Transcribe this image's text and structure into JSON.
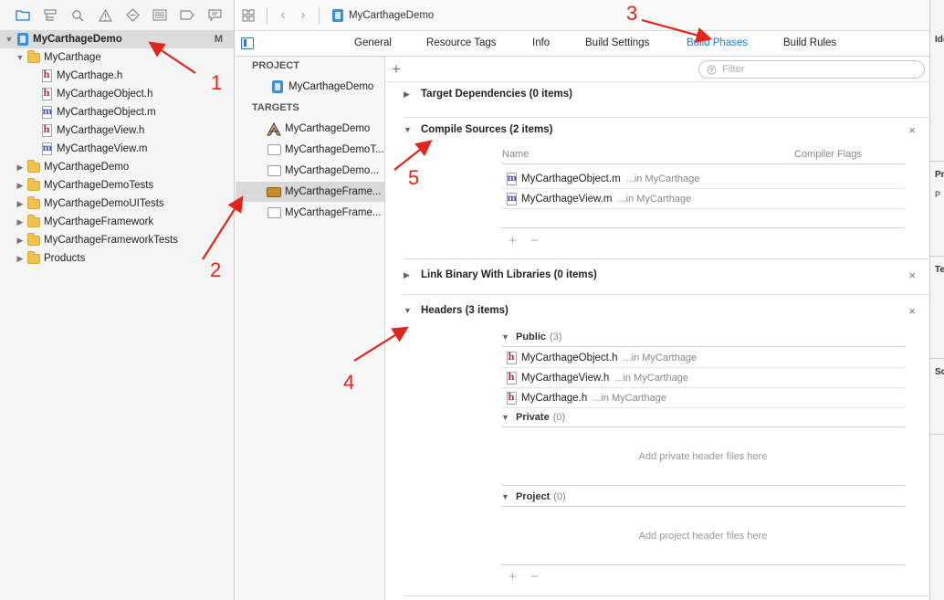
{
  "navigator": {
    "toolbar_icons": [
      "folder-icon",
      "hierarchy-icon",
      "search-icon",
      "warning-icon",
      "test-icon",
      "debug-list-icon",
      "breakpoint-icon",
      "report-icon"
    ],
    "items": [
      {
        "label": "MyCarthageDemo",
        "kind": "project",
        "disclosure": "▼",
        "badge": "M"
      },
      {
        "label": "MyCarthage",
        "kind": "folder",
        "disclosure": "▼"
      },
      {
        "label": "MyCarthage.h",
        "kind": "h"
      },
      {
        "label": "MyCarthageObject.h",
        "kind": "h"
      },
      {
        "label": "MyCarthageObject.m",
        "kind": "m"
      },
      {
        "label": "MyCarthageView.h",
        "kind": "h"
      },
      {
        "label": "MyCarthageView.m",
        "kind": "m"
      },
      {
        "label": "MyCarthageDemo",
        "kind": "folder",
        "disclosure": "▶"
      },
      {
        "label": "MyCarthageDemoTests",
        "kind": "folder",
        "disclosure": "▶"
      },
      {
        "label": "MyCarthageDemoUITests",
        "kind": "folder",
        "disclosure": "▶"
      },
      {
        "label": "MyCarthageFramework",
        "kind": "folder",
        "disclosure": "▶"
      },
      {
        "label": "MyCarthageFrameworkTests",
        "kind": "folder",
        "disclosure": "▶"
      },
      {
        "label": "Products",
        "kind": "folder",
        "disclosure": "▶"
      }
    ]
  },
  "topbar": {
    "breadcrumb": "MyCarthageDemo"
  },
  "tabs": {
    "general": "General",
    "resource_tags": "Resource Tags",
    "info": "Info",
    "build_settings": "Build Settings",
    "build_phases": "Build Phases",
    "build_rules": "Build Rules",
    "active": "Build Phases"
  },
  "targets_panel": {
    "project_header": "PROJECT",
    "project_item": "MyCarthageDemo",
    "targets_header": "TARGETS",
    "targets": [
      {
        "label": "MyCarthageDemo",
        "icon": "app-icon"
      },
      {
        "label": "MyCarthageDemoT...",
        "icon": "framework-icon"
      },
      {
        "label": "MyCarthageDemo...",
        "icon": "framework-icon"
      },
      {
        "label": "MyCarthageFrame...",
        "icon": "toolbox-icon",
        "selected": true
      },
      {
        "label": "MyCarthageFrame...",
        "icon": "framework-icon"
      }
    ]
  },
  "build_phases": {
    "filter_placeholder": "Filter",
    "target_dependencies": "Target Dependencies (0 items)",
    "compile_sources": {
      "title": "Compile Sources (2 items)",
      "col_name": "Name",
      "col_flags": "Compiler Flags",
      "files": [
        {
          "name": "MyCarthageObject.m",
          "location": "...in MyCarthage"
        },
        {
          "name": "MyCarthageView.m",
          "location": "...in MyCarthage"
        }
      ]
    },
    "link_binary": "Link Binary With Libraries (0 items)",
    "headers": {
      "title": "Headers (3 items)",
      "public_label": "Public",
      "public_count": "(3)",
      "public_files": [
        {
          "name": "MyCarthageObject.h",
          "location": "...in MyCarthage"
        },
        {
          "name": "MyCarthageView.h",
          "location": "...in MyCarthage"
        },
        {
          "name": "MyCarthage.h",
          "location": "...in MyCarthage"
        }
      ],
      "private_label": "Private",
      "private_count": "(0)",
      "private_empty": "Add private header files here",
      "project_label": "Project",
      "project_count": "(0)",
      "project_empty": "Add project header files here"
    }
  },
  "inspector": {
    "labels": [
      "Ide",
      "Pr",
      "P",
      "Te",
      "Sc"
    ]
  },
  "annotations": {
    "color": "#e0261c",
    "numbers": [
      "1",
      "2",
      "3",
      "4",
      "5"
    ]
  }
}
